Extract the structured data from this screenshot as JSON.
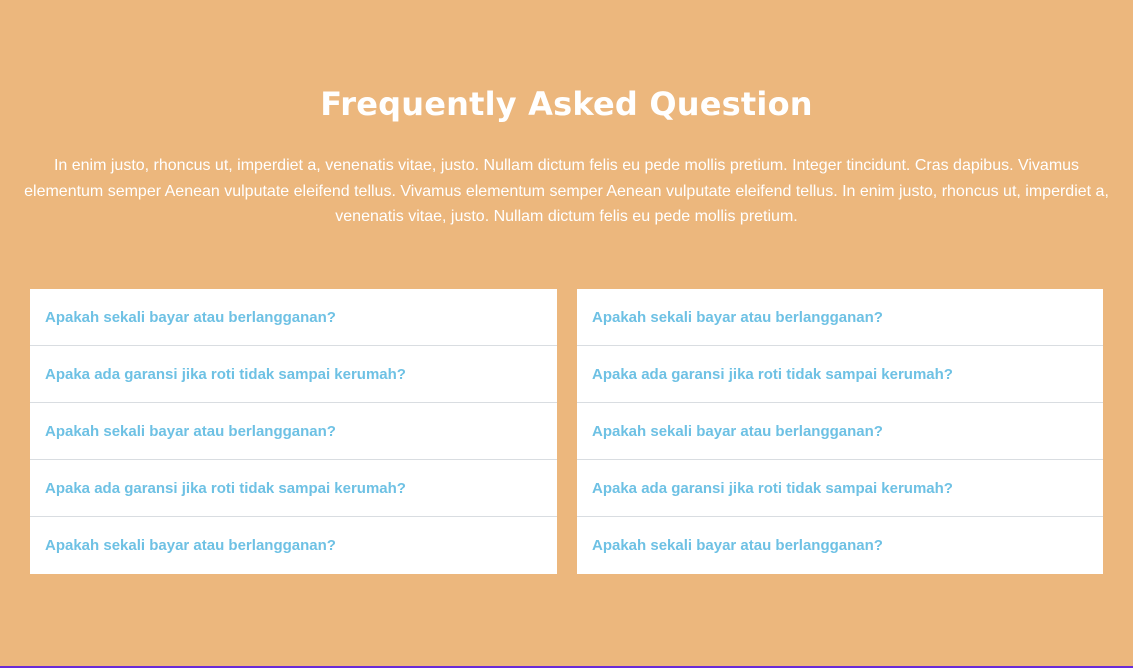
{
  "faq": {
    "title": "Frequently Asked Question",
    "description": "In enim justo, rhoncus ut, imperdiet a, venenatis vitae, justo. Nullam dictum felis eu pede mollis pretium. Integer tincidunt. Cras dapibus. Vivamus elementum semper Aenean vulputate eleifend tellus. Vivamus elementum semper Aenean vulputate eleifend tellus. In enim justo, rhoncus ut, imperdiet a, venenatis vitae, justo. Nullam dictum felis eu pede mollis pretium.",
    "left_column": [
      {
        "question": "Apakah sekali bayar atau berlangganan?"
      },
      {
        "question": "Apaka ada garansi jika roti tidak sampai kerumah?"
      },
      {
        "question": "Apakah sekali bayar atau berlangganan?"
      },
      {
        "question": "Apaka ada garansi jika roti tidak sampai kerumah?"
      },
      {
        "question": "Apakah sekali bayar atau berlangganan?"
      }
    ],
    "right_column": [
      {
        "question": "Apakah sekali bayar atau berlangganan?"
      },
      {
        "question": "Apaka ada garansi jika roti tidak sampai kerumah?"
      },
      {
        "question": "Apakah sekali bayar atau berlangganan?"
      },
      {
        "question": "Apaka ada garansi jika roti tidak sampai kerumah?"
      },
      {
        "question": "Apakah sekali bayar atau berlangganan?"
      }
    ]
  },
  "colors": {
    "background": "#ECB77D",
    "question_text": "#6EC1E4",
    "heading_text": "#FFFFFF",
    "card_background": "#FFFFFF",
    "divider": "#D9DDE1"
  }
}
